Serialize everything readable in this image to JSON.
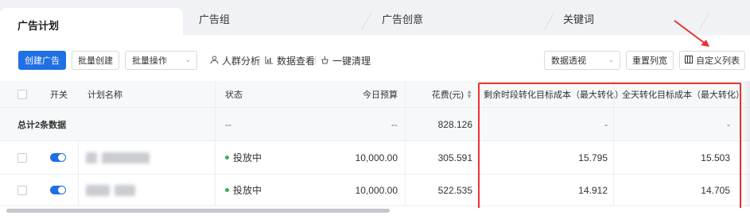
{
  "tabs": [
    {
      "label": "广告计划",
      "active": true
    },
    {
      "label": "广告组",
      "active": false
    },
    {
      "label": "广告创意",
      "active": false
    },
    {
      "label": "关键词",
      "active": false
    }
  ],
  "toolbar": {
    "create_label": "创建广告",
    "batch_create_label": "批量创建",
    "batch_ops_label": "批量操作",
    "crowd_label": "人群分析",
    "data_view_label": "数据查看",
    "clean_label": "一键清理",
    "pivot_label": "数据透视",
    "reset_width_label": "重置列宽",
    "custom_columns_label": "自定义列表"
  },
  "table": {
    "headers": {
      "toggle": "开关",
      "name": "计划名称",
      "status": "状态",
      "budget": "今日预算",
      "spend": "花费(元)",
      "remaining_cost": "剩余时段转化目标成本（最大转化）",
      "full_day_cost": "全天转化目标成本（最大转化）"
    },
    "total": {
      "label": "总计2条数据",
      "status": "--",
      "budget": "--",
      "spend": "828.126",
      "remaining_cost": "-",
      "full_day_cost": "-"
    },
    "rows": [
      {
        "status": "投放中",
        "budget": "10,000.00",
        "spend": "305.591",
        "remaining_cost": "15.795",
        "full_day_cost": "15.503"
      },
      {
        "status": "投放中",
        "budget": "10,000.00",
        "spend": "522.535",
        "remaining_cost": "14.912",
        "full_day_cost": "14.705"
      }
    ]
  },
  "colors": {
    "primary": "#1f6fe5",
    "annotation_red": "#e8322e",
    "status_green": "#2db35a"
  },
  "icons": [
    "person-icon",
    "bar-chart-icon",
    "broom-icon",
    "grid-icon",
    "chevron-down-icon",
    "sort-icon"
  ]
}
